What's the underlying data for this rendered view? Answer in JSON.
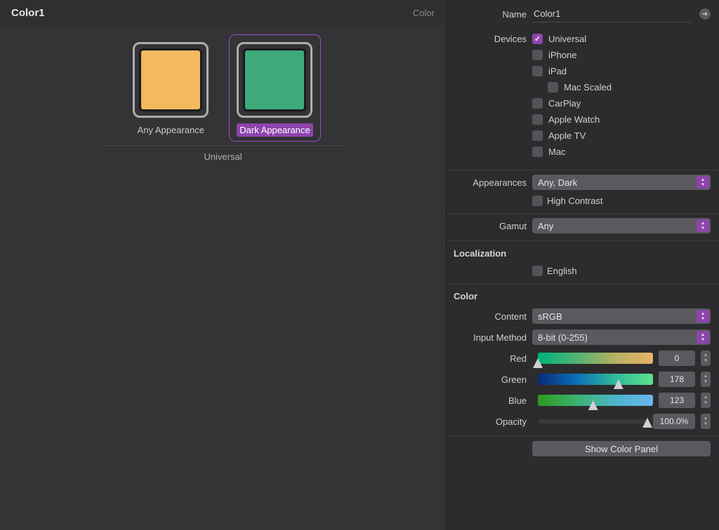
{
  "left": {
    "title": "Color1",
    "kind_label": "Color",
    "swatches": [
      {
        "label": "Any Appearance",
        "hex": "#f2b95f",
        "selected": false
      },
      {
        "label": "Dark Appearance",
        "hex": "#3faa79",
        "selected": true
      }
    ],
    "group_label": "Universal"
  },
  "inspector": {
    "name_label": "Name",
    "name_value": "Color1",
    "devices_label": "Devices",
    "devices": [
      {
        "label": "Universal",
        "checked": true,
        "indent": 0
      },
      {
        "label": "iPhone",
        "checked": false,
        "indent": 0
      },
      {
        "label": "iPad",
        "checked": false,
        "indent": 0
      },
      {
        "label": "Mac Scaled",
        "checked": false,
        "indent": 1
      },
      {
        "label": "CarPlay",
        "checked": false,
        "indent": 0
      },
      {
        "label": "Apple Watch",
        "checked": false,
        "indent": 0
      },
      {
        "label": "Apple TV",
        "checked": false,
        "indent": 0
      },
      {
        "label": "Mac",
        "checked": false,
        "indent": 0
      }
    ],
    "appearances_label": "Appearances",
    "appearances_value": "Any, Dark",
    "high_contrast_label": "High Contrast",
    "high_contrast_checked": false,
    "gamut_label": "Gamut",
    "gamut_value": "Any",
    "localization_heading": "Localization",
    "localization_english_label": "English",
    "localization_english_checked": false,
    "color_heading": "Color",
    "content_label": "Content",
    "content_value": "sRGB",
    "input_method_label": "Input Method",
    "input_method_value": "8-bit (0-255)",
    "sliders": {
      "red": {
        "label": "Red",
        "value": "0",
        "pos": 0
      },
      "green": {
        "label": "Green",
        "value": "178",
        "pos": 70
      },
      "blue": {
        "label": "Blue",
        "value": "123",
        "pos": 48
      },
      "opacity": {
        "label": "Opacity",
        "value": "100.0%",
        "pos": 100
      }
    },
    "show_color_panel_label": "Show Color Panel"
  }
}
